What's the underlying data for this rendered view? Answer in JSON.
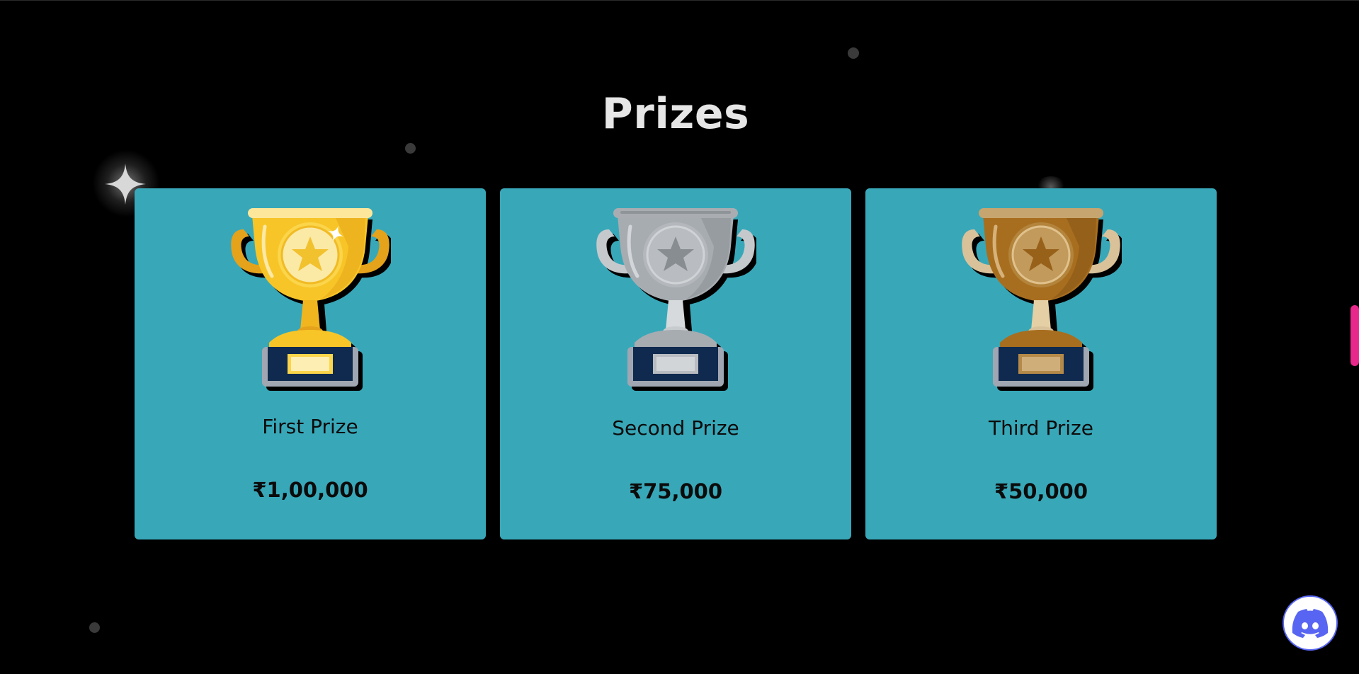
{
  "section": {
    "title": "Prizes"
  },
  "prizes": [
    {
      "name": "First Prize",
      "amount": "₹1,00,000",
      "tier": "gold"
    },
    {
      "name": "Second Prize",
      "amount": "₹75,000",
      "tier": "silver"
    },
    {
      "name": "Third Prize",
      "amount": "₹50,000",
      "tier": "bronze"
    }
  ],
  "colors": {
    "background": "#000000",
    "card": "#38a8b9",
    "title": "#e6e6e6",
    "text": "#0b0b0b",
    "scroll_indicator": "#e8288a",
    "discord": "#5865f2",
    "gold": "#f7c528",
    "silver": "#a7acb1",
    "bronze": "#a86e1f",
    "trophy_base": "#0f2a4e"
  },
  "icons": {
    "sparkle": "sparkle-icon",
    "discord": "discord-icon",
    "trophy": "trophy-icon"
  }
}
